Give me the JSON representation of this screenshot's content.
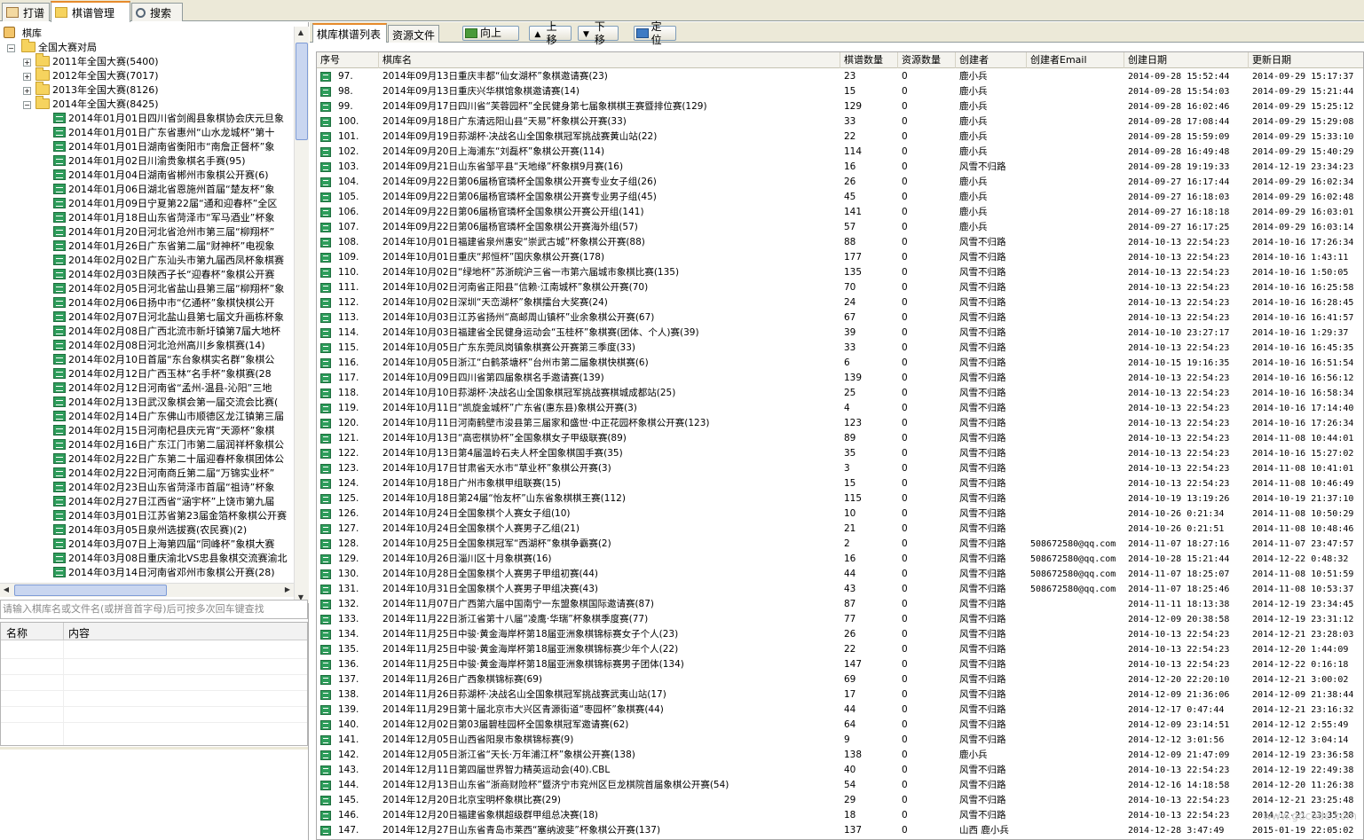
{
  "tabs": [
    "打谱",
    "棋谱管理",
    "搜索"
  ],
  "tree": {
    "root": "棋库",
    "level1": "全国大赛对局",
    "years": [
      "2011年全国大赛(5400)",
      "2012年全国大赛(7017)",
      "2013年全国大赛(8126)",
      "2014年全国大赛(8425)"
    ],
    "items": [
      "2014年01月01日四川省剑阁县象棋协会庆元旦象",
      "2014年01月01日广东省惠州“山水龙城杯”第十",
      "2014年01月01日湖南省衡阳市“南詹正督杯”象",
      "2014年01月02日川渝贵象棋名手赛(95)",
      "2014年01月04日湖南省郴州市象棋公开赛(6)",
      "2014年01月06日湖北省恩施州首届“楚友杯”象",
      "2014年01月09日宁夏第22届“通和迎春杯”全区",
      "2014年01月18日山东省菏泽市“军马酒业”杯象",
      "2014年01月20日河北省沧州市第三届“柳翔杯”",
      "2014年01月26日广东省第二届“财神杯”电视象",
      "2014年02月02日广东汕头市第九届西凤杯象棋赛",
      "2014年02月03日陕西子长“迎春杯”象棋公开赛",
      "2014年02月05日河北省盐山县第三届“柳翔杯”象",
      "2014年02月06日扬中市“亿通杯”象棋快棋公开",
      "2014年02月07日河北盐山县第七届文升画栋杯象",
      "2014年02月08日广西北流市新圩镇第7届大地杯",
      "2014年02月08日河北沧州高川乡象棋赛(14)",
      "2014年02月10日首届“东台象棋实名群”象棋公",
      "2014年02月12日广西玉林“名手杯”象棋赛(28",
      "2014年02月12日河南省“孟州-温县-沁阳”三地",
      "2014年02月13日武汉象棋会第一届交流会比赛(",
      "2014年02月14日广东佛山市顺德区龙江镇第三届",
      "2014年02月15日河南杞县庆元宵“天源杯”象棋",
      "2014年02月16日广东江门市第二届润祥杯象棋公",
      "2014年02月22日广东第二十届迎春杯象棋团体公",
      "2014年02月22日河南商丘第二届“万锦实业杯”",
      "2014年02月23日山东省菏泽市首届“祖诗”杯象",
      "2014年02月27日江西省“涵宇杯”上饶市第九届",
      "2014年03月01日江苏省第23届金箔杯象棋公开赛",
      "2014年03月05日泉州选拔赛(农民赛)(2)",
      "2014年03月07日上海第四届“同峰杯”象棋大赛",
      "2014年03月08日重庆渝北VS忠县象棋交流赛渝北",
      "2014年03月14日河南省邓州市象棋公开赛(28)"
    ]
  },
  "search": {
    "placeholder": "请输入棋库名或文件名(或拼音首字母)后可按多次回车键查找"
  },
  "props": {
    "col_name": "名称",
    "col_content": "内容"
  },
  "subtabs": [
    "棋库棋谱列表",
    "资源文件"
  ],
  "toolbar": {
    "up": "向上",
    "moveup": "上移",
    "movedown": "下移",
    "locate": "定位"
  },
  "columns": [
    "序号",
    "棋库名",
    "棋谱数量",
    "资源数量",
    "创建者",
    "创建者Email",
    "创建日期",
    "更新日期"
  ],
  "rows": [
    [
      "97.",
      "2014年09月13日重庆丰都“仙女湖杯”象棋邀请赛(23)",
      "23",
      "0",
      "鹿小兵",
      "",
      "2014-09-28 15:52:44",
      "2014-09-29 15:17:37"
    ],
    [
      "98.",
      "2014年09月13日重庆兴华棋馆象棋邀请赛(14)",
      "15",
      "0",
      "鹿小兵",
      "",
      "2014-09-28 15:54:03",
      "2014-09-29 15:21:44"
    ],
    [
      "99.",
      "2014年09月17日四川省“芙蓉园杯”全民健身第七届象棋棋王赛暨排位赛(129)",
      "129",
      "0",
      "鹿小兵",
      "",
      "2014-09-28 16:02:46",
      "2014-09-29 15:25:12"
    ],
    [
      "100.",
      "2014年09月18日广东清远阳山县“天易”杯象棋公开赛(33)",
      "33",
      "0",
      "鹿小兵",
      "",
      "2014-09-28 17:08:44",
      "2014-09-29 15:29:08"
    ],
    [
      "101.",
      "2014年09月19日荪湖杯·决战名山全国象棋冠军挑战赛黄山站(22)",
      "22",
      "0",
      "鹿小兵",
      "",
      "2014-09-28 15:59:09",
      "2014-09-29 15:33:10"
    ],
    [
      "102.",
      "2014年09月20日上海浦东“刘磊杯”象棋公开赛(114)",
      "114",
      "0",
      "鹿小兵",
      "",
      "2014-09-28 16:49:48",
      "2014-09-29 15:40:29"
    ],
    [
      "103.",
      "2014年09月21日山东省邹平县“天地缘”杯象棋9月赛(16)",
      "16",
      "0",
      "风雪不归路",
      "",
      "2014-09-28 19:19:33",
      "2014-12-19 23:34:23"
    ],
    [
      "104.",
      "2014年09月22日第06届杨官璘杯全国象棋公开赛专业女子组(26)",
      "26",
      "0",
      "鹿小兵",
      "",
      "2014-09-27 16:17:44",
      "2014-09-29 16:02:34"
    ],
    [
      "105.",
      "2014年09月22日第06届杨官璘杯全国象棋公开赛专业男子组(45)",
      "45",
      "0",
      "鹿小兵",
      "",
      "2014-09-27 16:18:03",
      "2014-09-29 16:02:48"
    ],
    [
      "106.",
      "2014年09月22日第06届杨官璘杯全国象棋公开赛公开组(141)",
      "141",
      "0",
      "鹿小兵",
      "",
      "2014-09-27 16:18:18",
      "2014-09-29 16:03:01"
    ],
    [
      "107.",
      "2014年09月22日第06届杨官璘杯全国象棋公开赛海外组(57)",
      "57",
      "0",
      "鹿小兵",
      "",
      "2014-09-27 16:17:25",
      "2014-09-29 16:03:14"
    ],
    [
      "108.",
      "2014年10月01日福建省泉州惠安“崇武古城”杯象棋公开赛(88)",
      "88",
      "0",
      "风雪不归路",
      "",
      "2014-10-13 22:54:23",
      "2014-10-16 17:26:34"
    ],
    [
      "109.",
      "2014年10月01日重庆“邦恒杯”国庆象棋公开赛(178)",
      "177",
      "0",
      "风雪不归路",
      "",
      "2014-10-13 22:54:23",
      "2014-10-16 1:43:11"
    ],
    [
      "110.",
      "2014年10月02日“绿地杯”苏浙皖沪三省一市第六届城市象棋比赛(135)",
      "135",
      "0",
      "风雪不归路",
      "",
      "2014-10-13 22:54:23",
      "2014-10-16 1:50:05"
    ],
    [
      "111.",
      "2014年10月02日河南省正阳县“信赖·江南城杯”象棋公开赛(70)",
      "70",
      "0",
      "风雪不归路",
      "",
      "2014-10-13 22:54:23",
      "2014-10-16 16:25:58"
    ],
    [
      "112.",
      "2014年10月02日深圳“天峦湖杯”象棋擂台大奖赛(24)",
      "24",
      "0",
      "风雪不归路",
      "",
      "2014-10-13 22:54:23",
      "2014-10-16 16:28:45"
    ],
    [
      "113.",
      "2014年10月03日江苏省扬州“高邮周山镇杯”业余象棋公开赛(67)",
      "67",
      "0",
      "风雪不归路",
      "",
      "2014-10-13 22:54:23",
      "2014-10-16 16:41:57"
    ],
    [
      "114.",
      "2014年10月03日福建省全民健身运动会“玉桂杯”象棋赛(团体、个人)赛(39)",
      "39",
      "0",
      "风雪不归路",
      "",
      "2014-10-10 23:27:17",
      "2014-10-16 1:29:37"
    ],
    [
      "115.",
      "2014年10月05日广东东莞凤岗镇象棋赛公开赛第三季度(33)",
      "33",
      "0",
      "风雪不归路",
      "",
      "2014-10-13 22:54:23",
      "2014-10-16 16:45:35"
    ],
    [
      "116.",
      "2014年10月05日浙江“白鹤茶塘杯”台州市第二届象棋快棋赛(6)",
      "6",
      "0",
      "风雪不归路",
      "",
      "2014-10-15 19:16:35",
      "2014-10-16 16:51:54"
    ],
    [
      "117.",
      "2014年10月09日四川省第四届象棋名手邀请赛(139)",
      "139",
      "0",
      "风雪不归路",
      "",
      "2014-10-13 22:54:23",
      "2014-10-16 16:56:12"
    ],
    [
      "118.",
      "2014年10月10日荪湖杯·决战名山全国象棋冠军挑战赛棋城成都站(25)",
      "25",
      "0",
      "风雪不归路",
      "",
      "2014-10-13 22:54:23",
      "2014-10-16 16:58:34"
    ],
    [
      "119.",
      "2014年10月11日“凯旋金城杯”广东省(惠东县)象棋公开赛(3)",
      "4",
      "0",
      "风雪不归路",
      "",
      "2014-10-13 22:54:23",
      "2014-10-16 17:14:40"
    ],
    [
      "120.",
      "2014年10月11日河南鹤壁市浚县第三届家和盛世·中正花园杯象棋公开赛(123)",
      "123",
      "0",
      "风雪不归路",
      "",
      "2014-10-13 22:54:23",
      "2014-10-16 17:26:34"
    ],
    [
      "121.",
      "2014年10月13日“高密棋协杯”全国象棋女子甲级联赛(89)",
      "89",
      "0",
      "风雪不归路",
      "",
      "2014-10-13 22:54:23",
      "2014-11-08 10:44:01"
    ],
    [
      "122.",
      "2014年10月13日第4届温岭石夫人杯全国象棋国手赛(35)",
      "35",
      "0",
      "风雪不归路",
      "",
      "2014-10-13 22:54:23",
      "2014-10-16 15:27:02"
    ],
    [
      "123.",
      "2014年10月17日甘肃省天水市“草业杯”象棋公开赛(3)",
      "3",
      "0",
      "风雪不归路",
      "",
      "2014-10-13 22:54:23",
      "2014-11-08 10:41:01"
    ],
    [
      "124.",
      "2014年10月18日广州市象棋甲组联赛(15)",
      "15",
      "0",
      "风雪不归路",
      "",
      "2014-10-13 22:54:23",
      "2014-11-08 10:46:49"
    ],
    [
      "125.",
      "2014年10月18日第24届“怡友杯”山东省象棋棋王赛(112)",
      "115",
      "0",
      "风雪不归路",
      "",
      "2014-10-19 13:19:26",
      "2014-10-19 21:37:10"
    ],
    [
      "126.",
      "2014年10月24日全国象棋个人赛女子组(10)",
      "10",
      "0",
      "风雪不归路",
      "",
      "2014-10-26 0:21:34",
      "2014-11-08 10:50:29"
    ],
    [
      "127.",
      "2014年10月24日全国象棋个人赛男子乙组(21)",
      "21",
      "0",
      "风雪不归路",
      "",
      "2014-10-26 0:21:51",
      "2014-11-08 10:48:46"
    ],
    [
      "128.",
      "2014年10月25日全国象棋冠军“西湖杯”象棋争霸赛(2)",
      "2",
      "0",
      "风雪不归路",
      "508672580@qq.com",
      "2014-11-07 18:27:16",
      "2014-11-07 23:47:57"
    ],
    [
      "129.",
      "2014年10月26日淄川区十月象棋赛(16)",
      "16",
      "0",
      "风雪不归路",
      "508672580@qq.com",
      "2014-10-28 15:21:44",
      "2014-12-22 0:48:32"
    ],
    [
      "130.",
      "2014年10月28日全国象棋个人赛男子甲组初赛(44)",
      "44",
      "0",
      "风雪不归路",
      "508672580@qq.com",
      "2014-11-07 18:25:07",
      "2014-11-08 10:51:59"
    ],
    [
      "131.",
      "2014年10月31日全国象棋个人赛男子甲组决赛(43)",
      "43",
      "0",
      "风雪不归路",
      "508672580@qq.com",
      "2014-11-07 18:25:46",
      "2014-11-08 10:53:37"
    ],
    [
      "132.",
      "2014年11月07日广西第六届中国南宁一东盟象棋国际邀请赛(87)",
      "87",
      "0",
      "风雪不归路",
      "",
      "2014-11-11 18:13:38",
      "2014-12-19 23:34:45"
    ],
    [
      "133.",
      "2014年11月22日浙江省第十八届“凌鹰·华瑞”杯象棋季度赛(77)",
      "77",
      "0",
      "风雪不归路",
      "",
      "2014-12-09 20:38:58",
      "2014-12-19 23:31:12"
    ],
    [
      "134.",
      "2014年11月25日中骏·黄金海岸杯第18届亚洲象棋锦标赛女子个人(23)",
      "26",
      "0",
      "风雪不归路",
      "",
      "2014-10-13 22:54:23",
      "2014-12-21 23:28:03"
    ],
    [
      "135.",
      "2014年11月25日中骏·黄金海岸杯第18届亚洲象棋锦标赛少年个人(22)",
      "22",
      "0",
      "风雪不归路",
      "",
      "2014-10-13 22:54:23",
      "2014-12-20 1:44:09"
    ],
    [
      "136.",
      "2014年11月25日中骏·黄金海岸杯第18届亚洲象棋锦标赛男子团体(134)",
      "147",
      "0",
      "风雪不归路",
      "",
      "2014-10-13 22:54:23",
      "2014-12-22 0:16:18"
    ],
    [
      "137.",
      "2014年11月26日广西象棋锦标赛(69)",
      "69",
      "0",
      "风雪不归路",
      "",
      "2014-12-20 22:20:10",
      "2014-12-21 3:00:02"
    ],
    [
      "138.",
      "2014年11月26日荪湖杯·决战名山全国象棋冠军挑战赛武夷山站(17)",
      "17",
      "0",
      "风雪不归路",
      "",
      "2014-12-09 21:36:06",
      "2014-12-09 21:38:44"
    ],
    [
      "139.",
      "2014年11月29日第十届北京市大兴区青源街道“枣园杯”象棋赛(44)",
      "44",
      "0",
      "风雪不归路",
      "",
      "2014-12-17 0:47:44",
      "2014-12-21 23:16:32"
    ],
    [
      "140.",
      "2014年12月02日第03届碧桂园杯全国象棋冠军邀请赛(62)",
      "64",
      "0",
      "风雪不归路",
      "",
      "2014-12-09 23:14:51",
      "2014-12-12 2:55:49"
    ],
    [
      "141.",
      "2014年12月05日山西省阳泉市象棋锦标赛(9)",
      "9",
      "0",
      "风雪不归路",
      "",
      "2014-12-12 3:01:56",
      "2014-12-12 3:04:14"
    ],
    [
      "142.",
      "2014年12月05日浙江省“天长·万年浦江杯”象棋公开赛(138)",
      "138",
      "0",
      "鹿小兵",
      "",
      "2014-12-09 21:47:09",
      "2014-12-19 23:36:58"
    ],
    [
      "143.",
      "2014年12月11日第四届世界智力精英运动会(40).CBL",
      "40",
      "0",
      "风雪不归路",
      "",
      "2014-10-13 22:54:23",
      "2014-12-19 22:49:38"
    ],
    [
      "144.",
      "2014年12月13日山东省“浙商财险杯”暨济宁市兖州区巨龙棋院首届象棋公开赛(54)",
      "54",
      "0",
      "风雪不归路",
      "",
      "2014-12-16 14:18:58",
      "2014-12-20 11:26:38"
    ],
    [
      "145.",
      "2014年12月20日北京宝明杯象棋比赛(29)",
      "29",
      "0",
      "风雪不归路",
      "",
      "2014-10-13 22:54:23",
      "2014-12-21 23:25:48"
    ],
    [
      "146.",
      "2014年12月20日福建省象棋超级群甲组总决赛(18)",
      "18",
      "0",
      "风雪不归路",
      "",
      "2014-10-13 22:54:23",
      "2014-12-21 23:35:28"
    ],
    [
      "147.",
      "2014年12月27日山东省青岛市莱西“塞纳波斐”杯象棋公开赛(137)",
      "137",
      "0",
      "山西 鹿小兵",
      "",
      "2014-12-28 3:47:49",
      "2015-01-19 22:05:02"
    ]
  ],
  "colors": {
    "accent": "#e68b2c",
    "file_icon": "#2e9d5b",
    "folder": "#f6d35e",
    "chrome": "#ece9d8"
  },
  "icons": {
    "tab1": "board-icon",
    "tab2": "folder-icon",
    "tab3": "magnifier-icon",
    "up": "arrow-up-icon",
    "moveup": "triangle-up-icon",
    "movedown": "triangle-down-icon",
    "locate": "locate-icon"
  }
}
